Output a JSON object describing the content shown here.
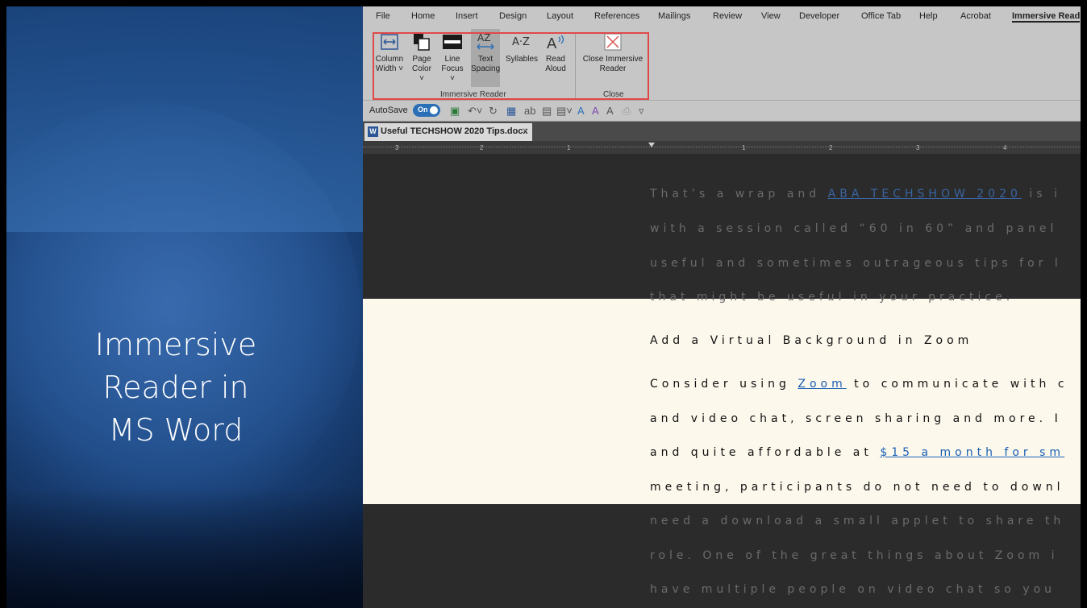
{
  "slide": {
    "title_lines": [
      "Immersive",
      "Reader in",
      "MS Word"
    ]
  },
  "menu": [
    "File",
    "Home",
    "Insert",
    "Design",
    "Layout",
    "References",
    "Mailings",
    "Review",
    "View",
    "Developer",
    "Office Tab",
    "Help",
    "Acrobat",
    "Immersive Read"
  ],
  "ribbon": {
    "buttons": [
      {
        "line1": "Column",
        "line2": "Width ˅"
      },
      {
        "line1": "Page",
        "line2": "Color ˅"
      },
      {
        "line1": "Line",
        "line2": "Focus ˅"
      },
      {
        "line1": "Text",
        "line2": "Spacing"
      },
      {
        "line1": "Syllables",
        "line2": ""
      },
      {
        "line1": "Read",
        "line2": "Aloud"
      },
      {
        "line1": "Close Immersive",
        "line2": "Reader"
      }
    ],
    "group1_label": "Immersive Reader",
    "group2_label": "Close"
  },
  "qat": {
    "autosave": "AutoSave",
    "toggle": "On"
  },
  "doc_tab": {
    "name": "Useful TECHSHOW 2020 Tips.docx",
    "icon": "W"
  },
  "ruler_ticks": [
    "3",
    "2",
    "1",
    "1",
    "2",
    "3",
    "4"
  ],
  "document": {
    "line1": {
      "a": "That’s a wrap and ",
      "link": "ABA TECHSHOW 2020",
      "b": " is i"
    },
    "line2": "with a session called “60 in 60” and panel",
    "line3": "useful and sometimes outrageous tips for l",
    "line4": "that might be useful in your practice.",
    "heading": "Add a Virtual Background in Zoom",
    "line5": {
      "a": "Consider using ",
      "link": "Zoom",
      "b": " to communicate with c"
    },
    "line6": "and video chat, screen sharing and more. I",
    "line7": {
      "a": "and quite affordable at ",
      "link": "$15 a month for sm"
    },
    "line8": "meeting, participants do not need to downl",
    "line9": "need a download a small applet to share th",
    "line10": "role. One of the great things about Zoom i",
    "line11": "have multiple people on video chat so you"
  }
}
